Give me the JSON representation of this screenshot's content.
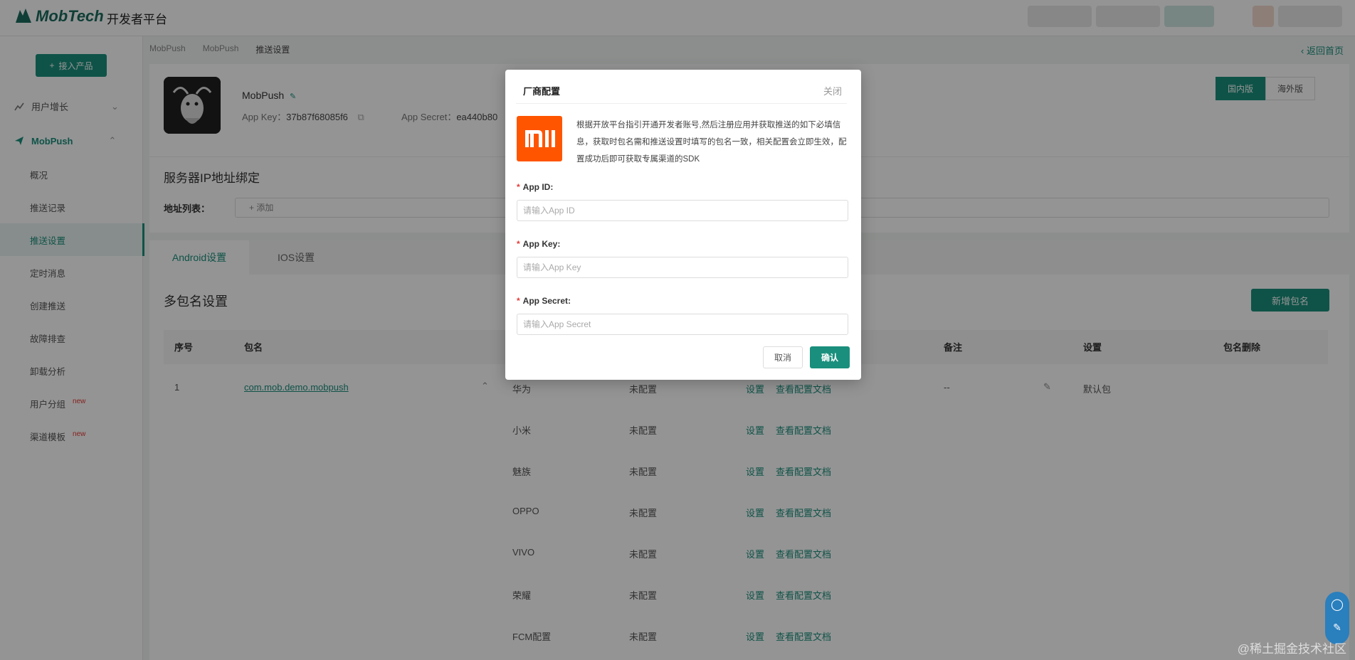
{
  "header": {
    "logo_text": "MobTech",
    "platform": "开发者平台"
  },
  "sidebar": {
    "add_product": "接入产品",
    "group_growth": "用户增长",
    "group_mobpush": "MobPush",
    "items": [
      {
        "label": "概况"
      },
      {
        "label": "推送记录"
      },
      {
        "label": "推送设置"
      },
      {
        "label": "定时消息"
      },
      {
        "label": "创建推送"
      },
      {
        "label": "故障排查"
      },
      {
        "label": "卸载分析"
      },
      {
        "label": "用户分组",
        "tag": "new"
      },
      {
        "label": "渠道模板",
        "tag": "new"
      }
    ]
  },
  "breadcrumb": [
    "MobPush",
    "MobPush",
    "推送设置"
  ],
  "back_home": "返回首页",
  "app": {
    "name": "MobPush",
    "app_key_label": "App Key：",
    "app_key": "37b87f68085f6",
    "app_secret_label": "App Secret：",
    "app_secret": "ea440b80"
  },
  "region": {
    "domestic": "国内版",
    "overseas": "海外版"
  },
  "ip_section": {
    "title": "服务器IP地址绑定",
    "list_label": "地址列表：",
    "add": "添加"
  },
  "tabs": {
    "android": "Android设置",
    "ios": "IOS设置"
  },
  "multi": {
    "title": "多包名设置",
    "new_button": "新增包名",
    "columns": [
      "序号",
      "包名",
      "备注",
      "设置",
      "包名删除"
    ],
    "row": {
      "index": "1",
      "package": "com.mob.demo.mobpush",
      "remark": "--",
      "setting": "默认包"
    },
    "vendors": [
      {
        "name": "华为",
        "status": "未配置",
        "action": "设置",
        "doc": "查看配置文档"
      },
      {
        "name": "小米",
        "status": "未配置",
        "action": "设置",
        "doc": "查看配置文档"
      },
      {
        "name": "魅族",
        "status": "未配置",
        "action": "设置",
        "doc": "查看配置文档"
      },
      {
        "name": "OPPO",
        "status": "未配置",
        "action": "设置",
        "doc": "查看配置文档"
      },
      {
        "name": "VIVO",
        "status": "未配置",
        "action": "设置",
        "doc": "查看配置文档"
      },
      {
        "name": "荣耀",
        "status": "未配置",
        "action": "设置",
        "doc": "查看配置文档"
      },
      {
        "name": "FCM配置",
        "status": "未配置",
        "action": "设置",
        "doc": "查看配置文档"
      }
    ]
  },
  "dialog": {
    "title": "厂商配置",
    "close": "关闭",
    "description": "根据开放平台指引开通开发者账号,然后注册应用并获取推送的如下必填信息，获取时包名需和推送设置时填写的包名一致，相关配置会立即生效，配置成功后即可获取专属渠道的SDK",
    "fields": [
      {
        "label": "App ID:",
        "placeholder": "请输入App ID"
      },
      {
        "label": "App Key:",
        "placeholder": "请输入App Key"
      },
      {
        "label": "App Secret:",
        "placeholder": "请输入App Secret"
      }
    ],
    "cancel": "取消",
    "confirm": "确认"
  },
  "watermark": "@稀土掘金技术社区",
  "colors": {
    "accent": "#1a8f7d",
    "xiaomi": "#ff5500"
  }
}
